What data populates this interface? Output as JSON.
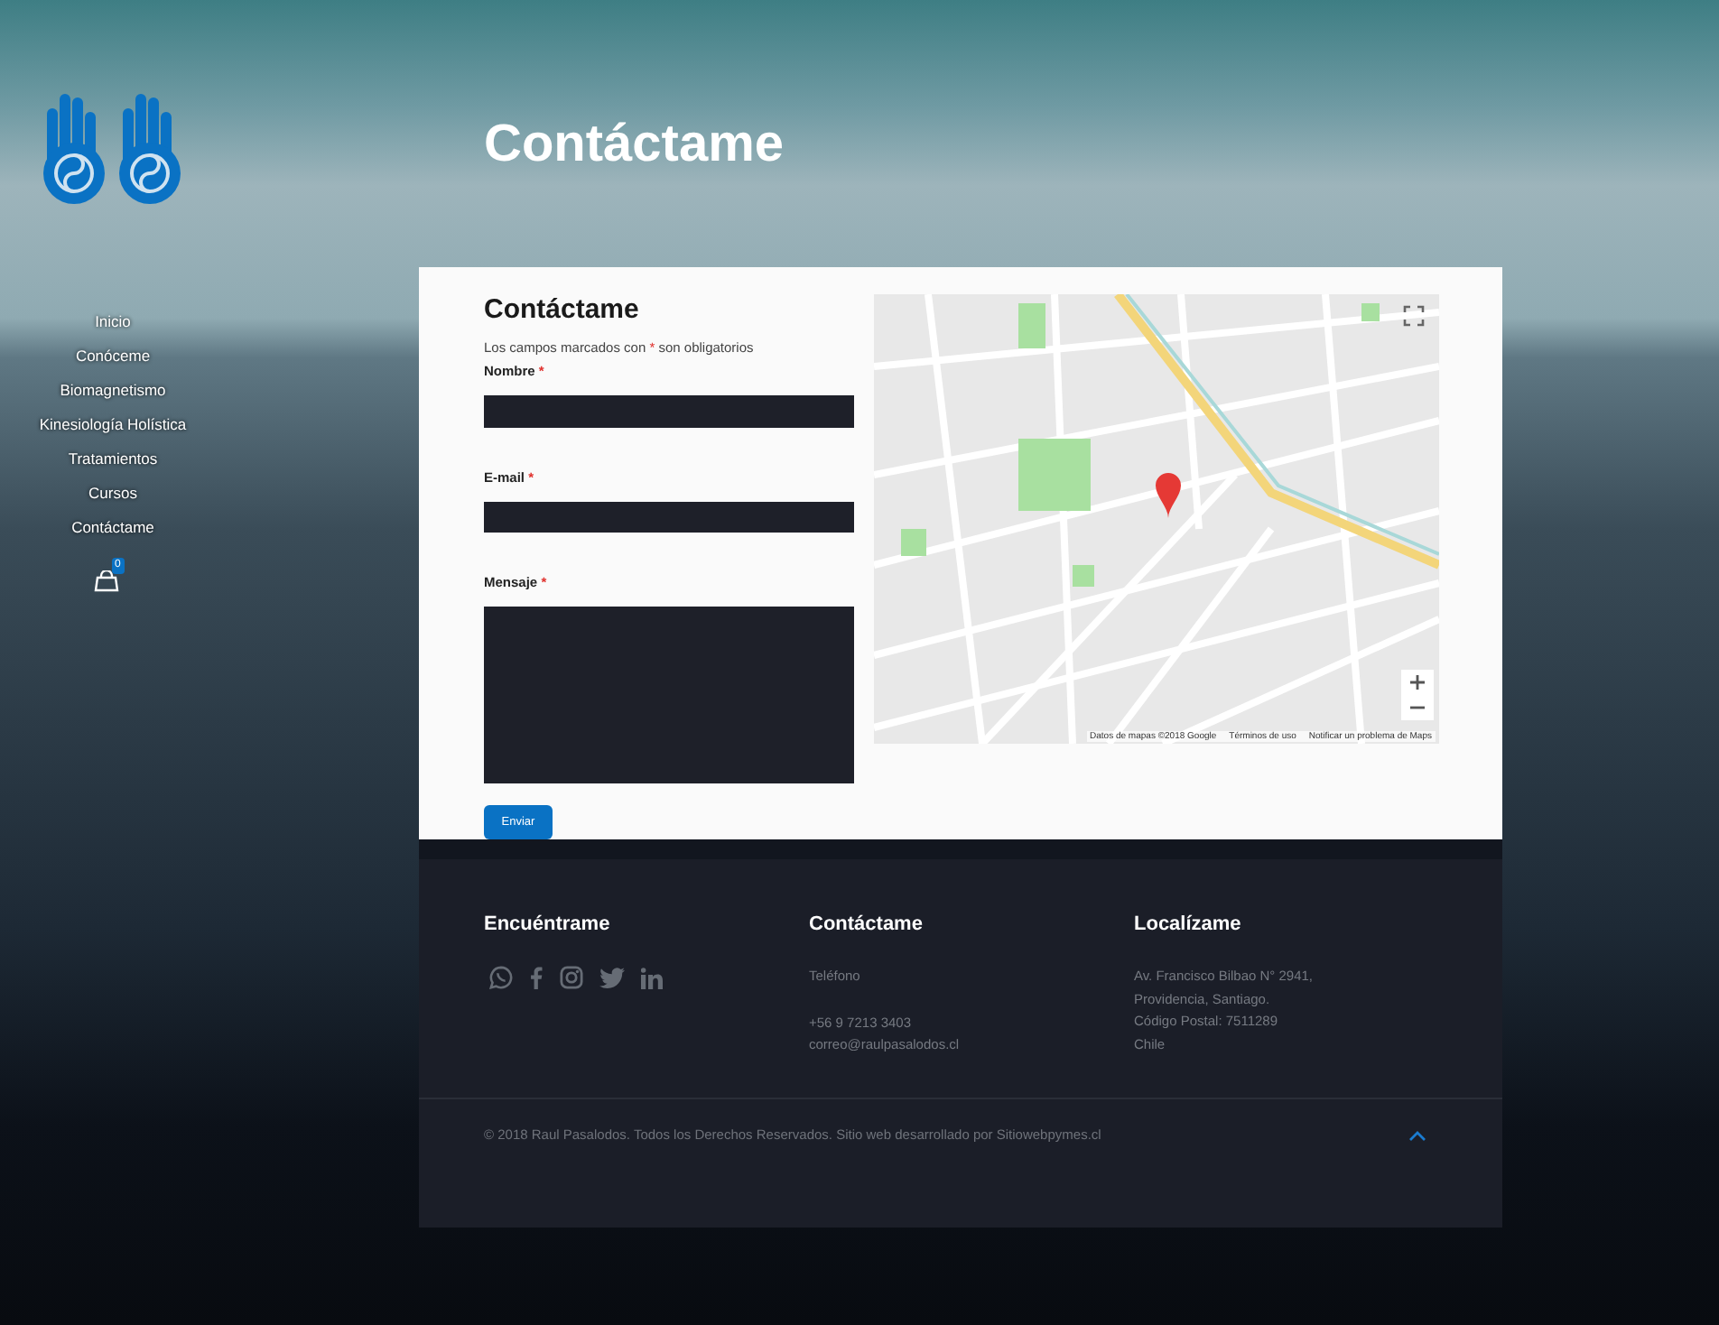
{
  "nav": [
    {
      "label": "Inicio"
    },
    {
      "label": "Conóceme"
    },
    {
      "label": "Biomagnetismo"
    },
    {
      "label": "Kinesiología Holística"
    },
    {
      "label": "Tratamientos"
    },
    {
      "label": "Cursos"
    },
    {
      "label": "Contáctame"
    }
  ],
  "cart": {
    "count": "0"
  },
  "page_title": "Contáctame",
  "form": {
    "title": "Contáctame",
    "note_before": "Los campos marcados con",
    "required_mark": "*",
    "note_after": "son obligatorios",
    "fields": [
      {
        "label": "Nombre",
        "required_mark": "*",
        "kind": "text"
      },
      {
        "label": "E-mail",
        "required_mark": "*",
        "kind": "text"
      },
      {
        "label": "Mensaje",
        "required_mark": "*",
        "kind": "textarea"
      }
    ],
    "submit": "Enviar"
  },
  "map": {
    "attribution": "Datos de mapas ©2018 Google",
    "terms": "Términos de uso",
    "report": "Notificar un problema de Maps"
  },
  "footer": {
    "columns": [
      {
        "kind": "social",
        "title": "Encuéntrame"
      },
      {
        "kind": "text",
        "title": "Contáctame",
        "paragraphs": [
          [
            "Teléfono"
          ],
          [
            "+56 9 7213 3403",
            "correo@raulpasalodos.cl"
          ]
        ]
      },
      {
        "kind": "text",
        "title": "Localízame",
        "paragraphs": [
          [
            "Av. Francisco Bilbao N° 2941,",
            "Providencia, Santiago.",
            "Código Postal: 7511289",
            "Chile"
          ]
        ]
      }
    ],
    "copyright": "© 2018 Raul Pasalodos. Todos los Derechos Reservados. Sitio web desarrollado por Sitiowebpymes.cl"
  }
}
